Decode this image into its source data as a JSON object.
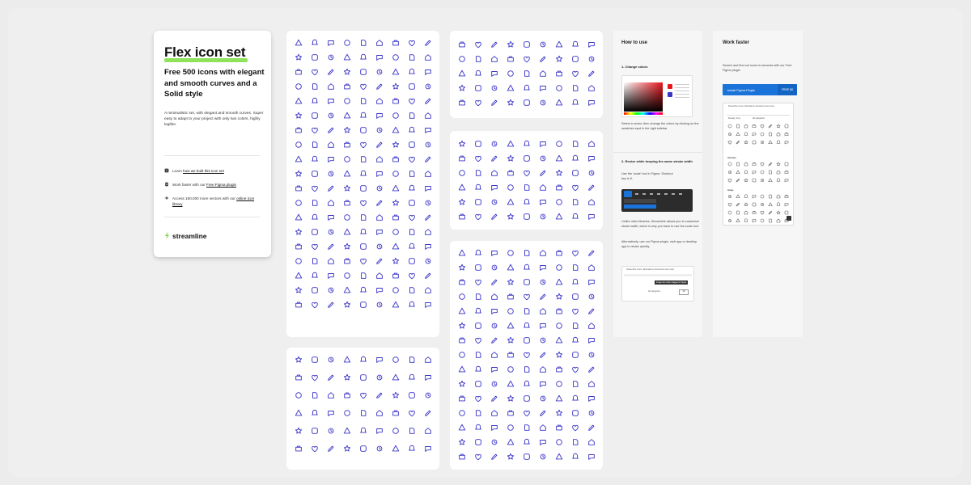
{
  "cover": {
    "title": "Flex icon set",
    "subtitle": "Free 500 icons with elegant and smooth curves and a Solid style",
    "description": "A minimalistic set, with elegant and smooth curves. Super easy to adapt to your project with only two colors, highly legible.",
    "features": [
      {
        "icon": "book-icon",
        "prefix": "Learn ",
        "link": "how we built this icon set",
        "suffix": ""
      },
      {
        "icon": "figma-icon",
        "prefix": "Work faster with our ",
        "link": "Free Figma plugin",
        "suffix": ""
      },
      {
        "icon": "sparkle-icon",
        "prefix": "Access 160,000 more vectors with our ",
        "link": "online icon library",
        "suffix": ""
      }
    ],
    "brand": "streamline"
  },
  "how_to_use": {
    "title": "How to use",
    "step1_title": "1- Change colors",
    "step1_text": "Select a vector, then change the colors by clicking on the swatches spot in the right sidebar",
    "step2_title": "2- Resize while keeping the same stroke width",
    "step2_text": "Use the 'scale' tool in Figma. Shortcut key is K.",
    "step2_text2": "Unlike other libraries, Streamline allows you to customize stroke width, which is why you have to use the scale tool.",
    "step2_text3": "Alternatively, use our Figma plugin, web app or desktop app to resize quickly.",
    "plugin_header": "Streamline Icons: Illustrations, Emoticons and more",
    "plugin_tooltip": "Image size when dragged in Figma",
    "plugin_category": "All categories",
    "plugin_size": "48"
  },
  "work_faster": {
    "title": "Work faster",
    "text": "Search and find our icons in seconds with our Free Figma plugin",
    "button_label": "Install Figma Plugin",
    "button_price": "FREE $0",
    "plugin_header": "Streamline Icons: Illustrations, Emoticons and more",
    "plugin_section1": "Interface",
    "plugin_section2": "Image",
    "plugin_filter": "Flexing / Line",
    "plugin_category": "All categories"
  },
  "colors": {
    "icon": "#3a34c9",
    "accent_green": "#8ee35a",
    "button_blue": "#1a73d9",
    "stage": "#efefef"
  }
}
